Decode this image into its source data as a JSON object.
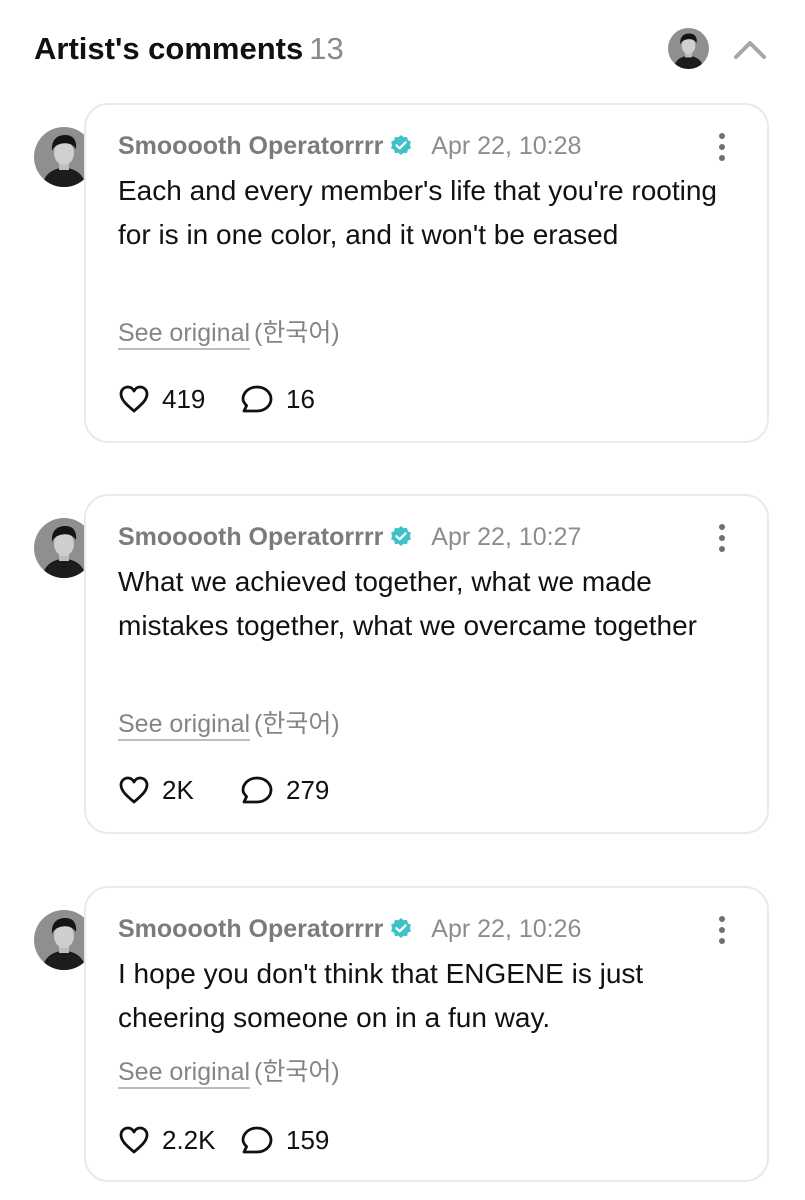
{
  "header": {
    "title": "Artist's comments",
    "count": "13",
    "collapse_icon": "chevron-up-icon"
  },
  "comments": [
    {
      "author": "Smooooth Operatorrrr",
      "verified": true,
      "time": "Apr 22, 10:28",
      "text": "Each and every member's life that you're rooting for is in one color, and it won't be erased",
      "see_original": "See original",
      "language": "(한국어)",
      "likes": "419",
      "replies": "16"
    },
    {
      "author": "Smooooth Operatorrrr",
      "verified": true,
      "time": "Apr 22, 10:27",
      "text": "What we achieved together, what we made mistakes together, what we overcame together",
      "see_original": "See original",
      "language": "(한국어)",
      "likes": "2K",
      "replies": "279"
    },
    {
      "author": "Smooooth Operatorrrr",
      "verified": true,
      "time": "Apr 22, 10:26",
      "text": "I hope you don't think that ENGENE is just cheering someone on in a fun way.",
      "see_original": "See original",
      "language": "(한국어)",
      "likes": "2.2K",
      "replies": "159"
    }
  ],
  "colors": {
    "verified_badge": "#3fc1c9",
    "card_border": "#e9e9ee",
    "muted_text": "#858585"
  }
}
